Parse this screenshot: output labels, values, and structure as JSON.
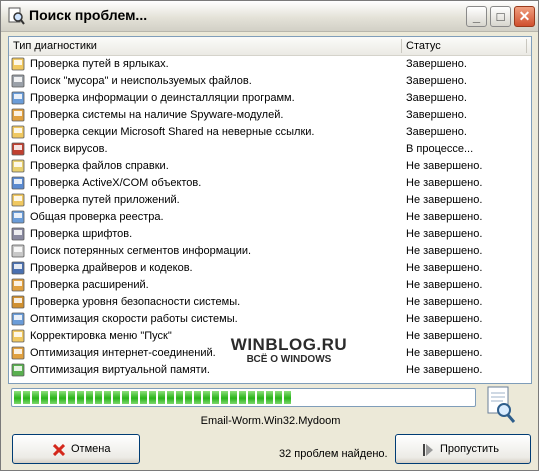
{
  "window": {
    "title": "Поиск проблем..."
  },
  "list": {
    "columns": [
      "Тип диагностики",
      "Статус"
    ],
    "rows": [
      {
        "name": "Проверка путей в ярлыках.",
        "status": "Завершено.",
        "icon": "shortcut-icon"
      },
      {
        "name": "Поиск \"мусора\" и неиспользуемых файлов.",
        "status": "Завершено.",
        "icon": "trash-icon"
      },
      {
        "name": "Проверка информации о деинсталляции программ.",
        "status": "Завершено.",
        "icon": "uninstall-icon"
      },
      {
        "name": "Проверка системы на наличие Spyware-модулей.",
        "status": "Завершено.",
        "icon": "spyware-icon"
      },
      {
        "name": "Проверка секции Microsoft Shared на неверные ссылки.",
        "status": "Завершено.",
        "icon": "folder-icon"
      },
      {
        "name": "Поиск вирусов.",
        "status": "В процессе...",
        "icon": "virus-icon"
      },
      {
        "name": "Проверка файлов справки.",
        "status": "Не завершено.",
        "icon": "help-file-icon"
      },
      {
        "name": "Проверка ActiveX/COM объектов.",
        "status": "Не завершено.",
        "icon": "activex-icon"
      },
      {
        "name": "Проверка путей приложений.",
        "status": "Не завершено.",
        "icon": "app-path-icon"
      },
      {
        "name": "Общая проверка реестра.",
        "status": "Не завершено.",
        "icon": "registry-icon"
      },
      {
        "name": "Проверка шрифтов.",
        "status": "Не завершено.",
        "icon": "font-icon"
      },
      {
        "name": "Поиск потерянных сегментов информации.",
        "status": "Не завершено.",
        "icon": "document-icon"
      },
      {
        "name": "Проверка драйверов и кодеков.",
        "status": "Не завершено.",
        "icon": "driver-icon"
      },
      {
        "name": "Проверка расширений.",
        "status": "Не завершено.",
        "icon": "extension-icon"
      },
      {
        "name": "Проверка уровня безопасности системы.",
        "status": "Не завершено.",
        "icon": "security-icon"
      },
      {
        "name": "Оптимизация скорости работы системы.",
        "status": "Не завершено.",
        "icon": "speed-icon"
      },
      {
        "name": "Корректировка меню \"Пуск\"",
        "status": "Не завершено.",
        "icon": "start-menu-icon"
      },
      {
        "name": "Оптимизация интернет-соединений.",
        "status": "Не завершено.",
        "icon": "internet-icon"
      },
      {
        "name": "Оптимизация виртуальной памяти.",
        "status": "Не завершено.",
        "icon": "memory-icon"
      }
    ]
  },
  "watermark": {
    "line1": "WINBLOG.RU",
    "line2": "ВСЁ О WINDOWS"
  },
  "progress": {
    "fraction": 0.61,
    "current_item": "Email-Worm.Win32.Mydoom"
  },
  "footer": {
    "cancel_label": "Отмена",
    "found_text": "32 проблем найдено.",
    "skip_label": "Пропустить"
  },
  "colors": {
    "progress_green": "#29b41a",
    "cancel_red": "#d4281c"
  }
}
